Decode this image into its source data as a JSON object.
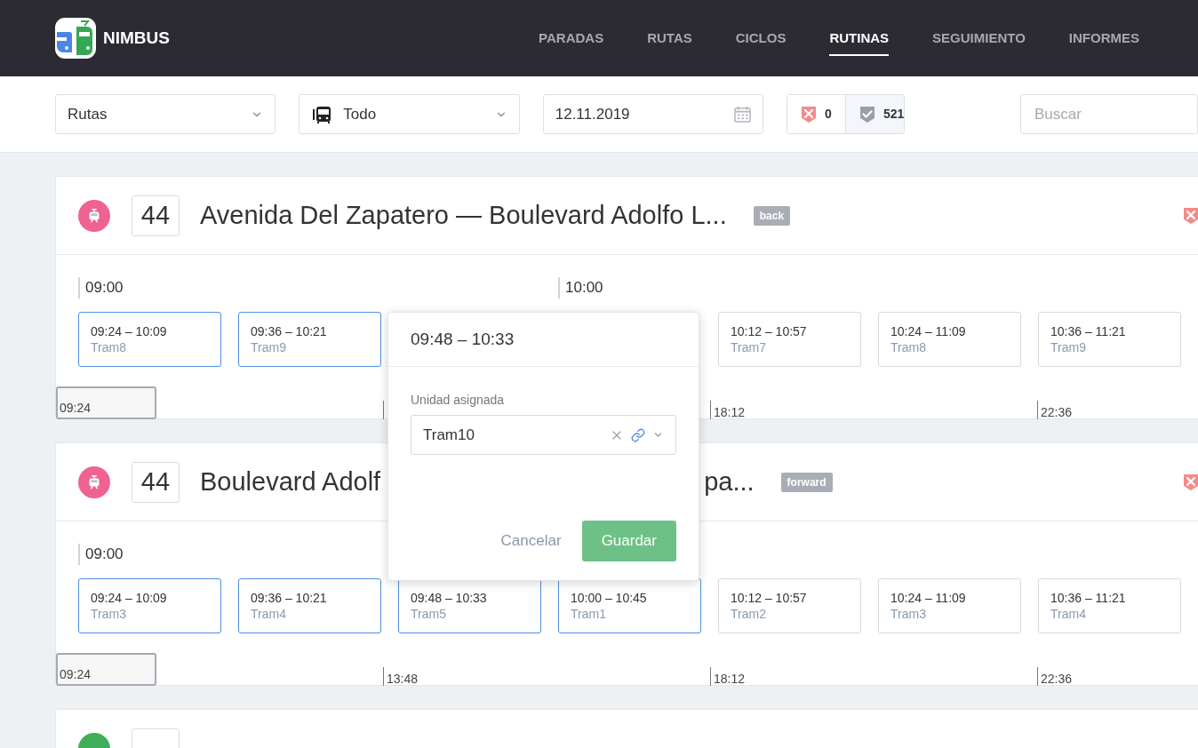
{
  "brand": {
    "name": "NIMBUS"
  },
  "nav": [
    {
      "label": "PARADAS",
      "selected": false
    },
    {
      "label": "RUTAS",
      "selected": false
    },
    {
      "label": "CICLOS",
      "selected": false
    },
    {
      "label": "RUTINAS",
      "selected": true
    },
    {
      "label": "SEGUIMIENTO",
      "selected": false
    },
    {
      "label": "INFORMES",
      "selected": false
    }
  ],
  "toolbar": {
    "mode_select": {
      "value": "Rutas"
    },
    "vehicle_select": {
      "value": "Todo"
    },
    "date_field": {
      "value": "12.11.2019"
    },
    "counters": [
      {
        "kind": "error",
        "count": "0",
        "selected": false
      },
      {
        "kind": "ok",
        "count": "521",
        "selected": true
      }
    ],
    "search": {
      "placeholder": "Buscar"
    }
  },
  "routes": [
    {
      "kind": "full",
      "color": "#ef6391",
      "number": "44",
      "title": "Avenida Del Zapatero — Boulevard Adolfo L...",
      "tag": "back",
      "hours": [
        "09:00",
        "10:00"
      ],
      "trips_left": [
        {
          "time": "09:24 – 10:09",
          "unit": "Tram8",
          "highlighted": true
        },
        {
          "time": "09:36 – 10:21",
          "unit": "Tram9",
          "highlighted": true
        }
      ],
      "trips_right": [
        {
          "time": "10:12 – 10:57",
          "unit": "Tram7",
          "highlighted": false
        },
        {
          "time": "10:24 – 11:09",
          "unit": "Tram8",
          "highlighted": false
        },
        {
          "time": "10:36 – 11:21",
          "unit": "Tram9",
          "highlighted": false
        }
      ],
      "scale": [
        {
          "kind": "handle",
          "label": "09:24"
        },
        {
          "kind": "tick"
        },
        {
          "kind": "tick",
          "label": "18:12"
        },
        {
          "kind": "tick",
          "label": "22:36"
        }
      ]
    },
    {
      "kind": "full",
      "color": "#ef6391",
      "number": "44",
      "title": "Boulevard Adolf",
      "title_end": "pa...",
      "tag": "forward",
      "hours": [
        "09:00"
      ],
      "trips_left": [
        {
          "time": "09:24 – 10:09",
          "unit": "Tram3",
          "highlighted": true
        },
        {
          "time": "09:36 – 10:21",
          "unit": "Tram4",
          "highlighted": true
        },
        {
          "time": "09:48 – 10:33",
          "unit": "Tram5",
          "highlighted": true
        },
        {
          "time": "10:00 – 10:45",
          "unit": "Tram1",
          "highlighted": true
        },
        {
          "time": "10:12 – 10:57",
          "unit": "Tram2",
          "highlighted": false
        },
        {
          "time": "10:24 – 11:09",
          "unit": "Tram3",
          "highlighted": false
        },
        {
          "time": "10:36 – 11:21",
          "unit": "Tram4",
          "highlighted": false
        }
      ],
      "scale": [
        {
          "kind": "handle",
          "label": "09:24"
        },
        {
          "kind": "tick",
          "label": "13:48"
        },
        {
          "kind": "tick",
          "label": "18:12"
        },
        {
          "kind": "tick",
          "label": "22:36"
        }
      ]
    },
    {
      "kind": "cut",
      "color": "#3fae5a"
    }
  ],
  "popup": {
    "title": "09:48 – 10:33",
    "field_label": "Unidad asignada",
    "field_value": "Tram10",
    "buttons": [
      {
        "kind": "cancel",
        "label": "Cancelar"
      },
      {
        "kind": "save",
        "label": "Guardar"
      }
    ]
  }
}
